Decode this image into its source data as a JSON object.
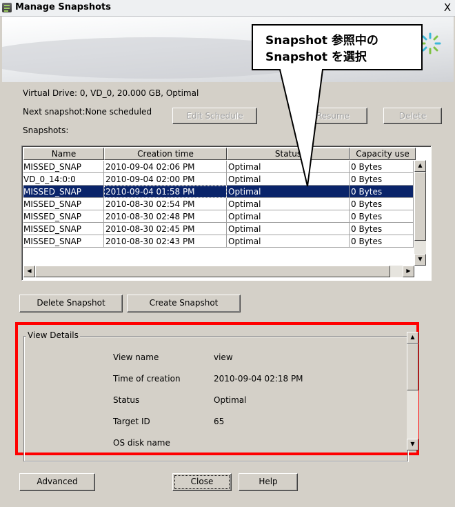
{
  "window": {
    "title": "Manage Snapshots",
    "close_glyph": "X"
  },
  "callout": {
    "line1": "Snapshot 参照中の",
    "line2": "Snapshot を選択"
  },
  "info": {
    "virtual_drive": "Virtual Drive: 0, VD_0, 20.000 GB, Optimal",
    "next_snapshot": "Next snapshot:None scheduled",
    "snapshots_label": "Snapshots:"
  },
  "toolbar": {
    "edit_schedule": "Edit Schedule",
    "resume": "Resume",
    "delete": "Delete"
  },
  "table": {
    "columns": [
      "Name",
      "Creation time",
      "Status",
      "Capacity use"
    ],
    "rows": [
      [
        "MISSED_SNAP",
        "2010-09-04 02:06 PM",
        "Optimal",
        "0 Bytes"
      ],
      [
        "VD_0_14:0:0",
        "2010-09-04 02:00 PM",
        "Optimal",
        "0 Bytes"
      ],
      [
        "MISSED_SNAP",
        "2010-09-04 01:58 PM",
        "Optimal",
        "0 Bytes"
      ],
      [
        "MISSED_SNAP",
        "2010-08-30 02:54 PM",
        "Optimal",
        "0 Bytes"
      ],
      [
        "MISSED_SNAP",
        "2010-08-30 02:48 PM",
        "Optimal",
        "0 Bytes"
      ],
      [
        "MISSED_SNAP",
        "2010-08-30 02:45 PM",
        "Optimal",
        "0 Bytes"
      ],
      [
        "MISSED_SNAP",
        "2010-08-30 02:43 PM",
        "Optimal",
        "0 Bytes"
      ]
    ],
    "selected_row_index": 2
  },
  "actions": {
    "delete_snapshot": "Delete Snapshot",
    "create_snapshot": "Create Snapshot"
  },
  "view_details": {
    "title": "View Details",
    "fields": [
      {
        "label": "View name",
        "value": "view"
      },
      {
        "label": "Time of creation",
        "value": "2010-09-04 02:18 PM"
      },
      {
        "label": "Status",
        "value": "Optimal"
      },
      {
        "label": "Target ID",
        "value": "65"
      },
      {
        "label": "OS disk name",
        "value": ""
      }
    ]
  },
  "footer": {
    "advanced": "Advanced",
    "close": "Close",
    "help": "Help"
  },
  "colors": {
    "selection": "#0a246a",
    "highlight_border": "#ff0000",
    "dialog_bg": "#d4d0c8"
  }
}
